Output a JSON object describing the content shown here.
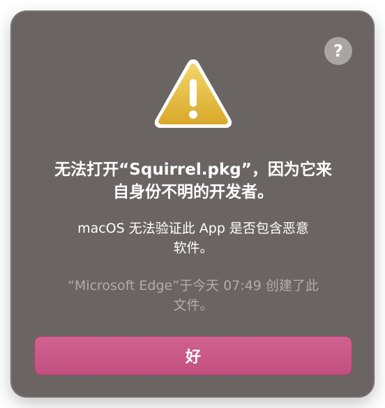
{
  "dialog": {
    "help_label": "?",
    "icon": "warning-triangle-icon",
    "title_line1": "无法打开“Squirrel.pkg”，因为它来",
    "title_line2": "自身份不明的开发者。",
    "message_line1": "macOS 无法验证此 App 是否包含恶意",
    "message_line2": "软件。",
    "info_line1": "“Microsoft Edge”于今天 07:49 创建了此",
    "info_line2": "文件。",
    "ok_label": "好"
  },
  "colors": {
    "dialog_bg": "#6a6563",
    "accent": "#c85a87",
    "warning_yellow": "#e2b638",
    "secondary_text": "#b2adab"
  }
}
